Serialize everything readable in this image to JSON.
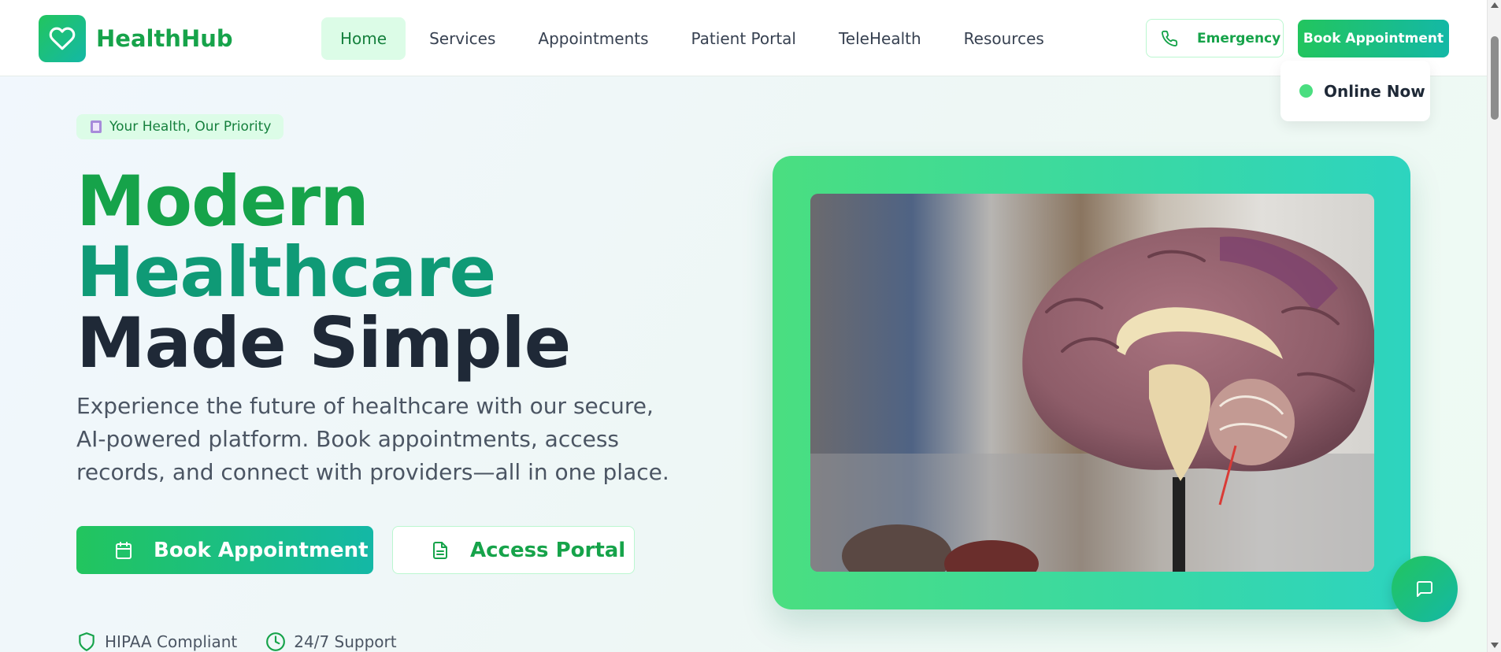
{
  "brand": {
    "name": "HealthHub"
  },
  "nav": {
    "links": [
      "Home",
      "Services",
      "Appointments",
      "Patient Portal",
      "TeleHealth",
      "Resources"
    ],
    "active": "Home",
    "emergency_label": "Emergency",
    "book_label": "Book Appointment"
  },
  "hero": {
    "tagline": "Your Health, Our Priority",
    "headline_line1": "Modern",
    "headline_line2": "Healthcare",
    "headline_line3": "Made Simple",
    "description": "Experience the future of healthcare with our secure, AI-powered platform. Book appointments, access records, and connect with providers—all in one place.",
    "primary_button": "Book Appointment",
    "secondary_button": "Access Portal",
    "badges": [
      "HIPAA Compliant",
      "24/7 Support"
    ]
  },
  "status": {
    "online_label": "Online Now"
  },
  "colors": {
    "brand_green": "#16a34a",
    "accent_teal": "#14b8a6",
    "headline_dark": "#1f2937"
  },
  "icons": [
    "heart-icon",
    "phone-icon",
    "calendar-icon",
    "document-icon",
    "shield-icon",
    "clock-icon",
    "chat-icon"
  ]
}
